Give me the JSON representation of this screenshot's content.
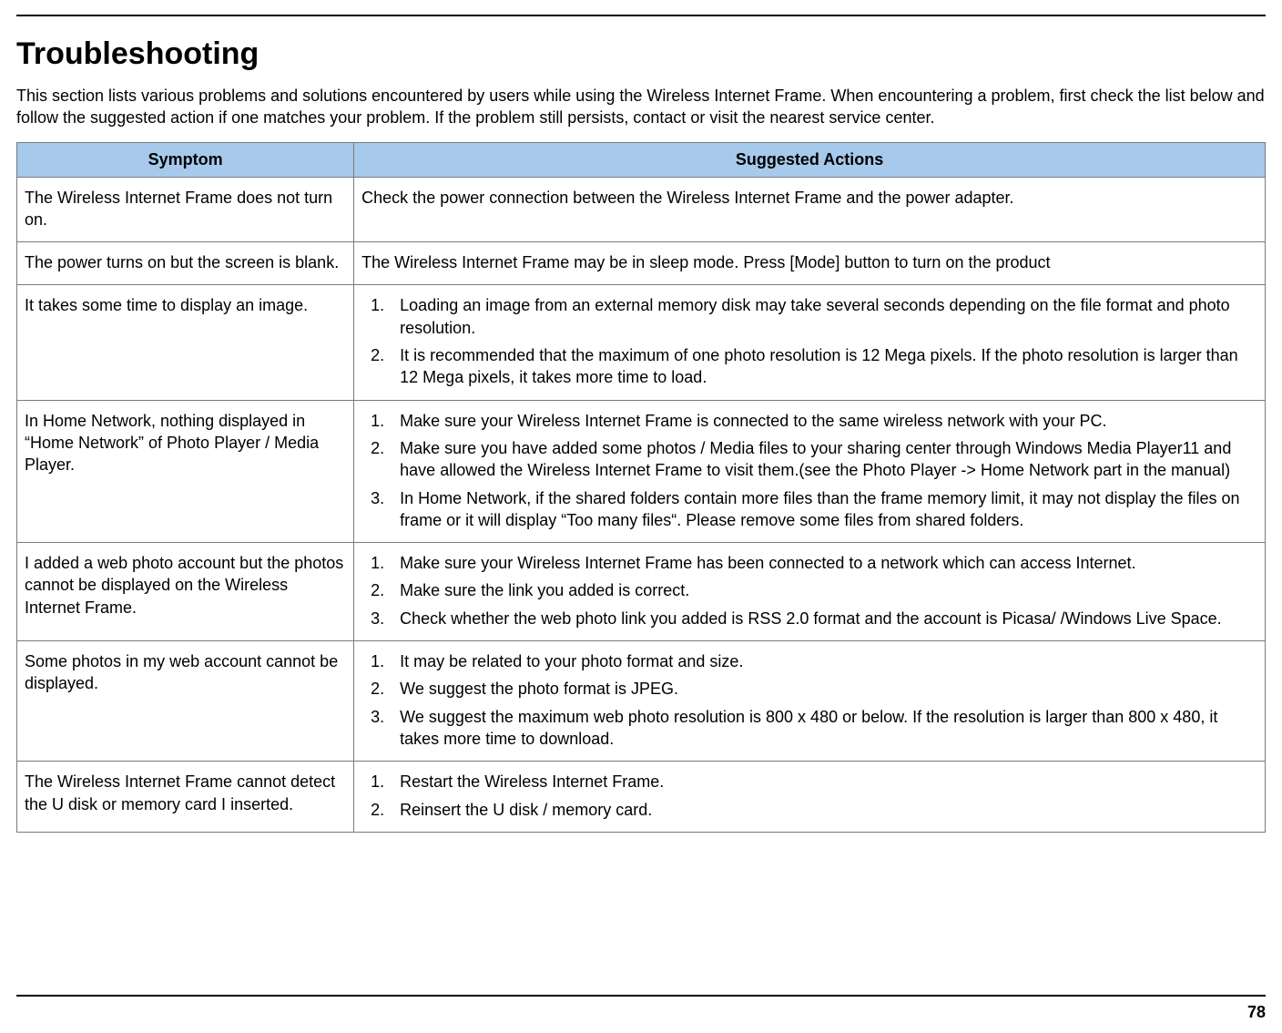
{
  "title": "Troubleshooting",
  "intro": "This section lists various problems and solutions encountered by users while using the Wireless Internet Frame.  When encountering a problem, first check the list below and follow the suggested action if one matches your problem.  If the problem still persists, contact or visit the nearest service center.",
  "table": {
    "headers": {
      "symptom": "Symptom",
      "actions": "Suggested Actions"
    },
    "rows": [
      {
        "symptom": "The Wireless Internet Frame does not turn on.",
        "actions_plain": "Check the power connection between the Wireless Internet Frame and the power adapter."
      },
      {
        "symptom": "The power turns on but the screen is blank.",
        "actions_plain": "The Wireless Internet Frame may be in sleep mode.  Press [Mode] button to turn on the product"
      },
      {
        "symptom": "It takes some time to display an image.",
        "actions_list": [
          "Loading an image from an external memory disk may take several seconds depending on the file format and photo resolution.",
          "It is recommended that the maximum of one photo resolution is 12 Mega pixels.  If the photo resolution is larger than 12 Mega pixels, it takes more time to load."
        ]
      },
      {
        "symptom": "In Home Network, nothing displayed in “Home Network” of Photo Player / Media Player.",
        "actions_list": [
          "Make sure your Wireless Internet Frame is connected to the same wireless network with your PC.",
          "Make sure you have added some photos / Media files to your sharing center through Windows Media Player11 and have allowed the Wireless Internet Frame to visit them.(see the Photo Player -> Home Network part in the manual)",
          "In Home Network, if the shared folders contain more files than the frame memory limit, it may not display the files on frame or it will display “Too many files“. Please remove some files from shared folders."
        ]
      },
      {
        "symptom": "I added a web photo account but the photos cannot be displayed on the Wireless Internet Frame.",
        "actions_list": [
          "Make sure your Wireless Internet Frame has been connected to a network which can access Internet.",
          "Make sure the link you added is correct.",
          "Check whether the web photo link you added is RSS 2.0 format and the account is Picasa/ /Windows Live Space."
        ]
      },
      {
        "symptom": "Some photos in my web account cannot be displayed.",
        "actions_list": [
          "It may be related to your photo format and size.",
          "We suggest the photo format is JPEG.",
          "We suggest the maximum web photo resolution is 800 x 480 or below. If the resolution is larger than 800 x 480, it takes more time to download."
        ]
      },
      {
        "symptom": "The Wireless Internet Frame cannot detect the U disk or memory card I inserted.",
        "actions_list": [
          "Restart the Wireless Internet Frame.",
          "Reinsert the U disk / memory card."
        ]
      }
    ]
  },
  "page_number": "78"
}
